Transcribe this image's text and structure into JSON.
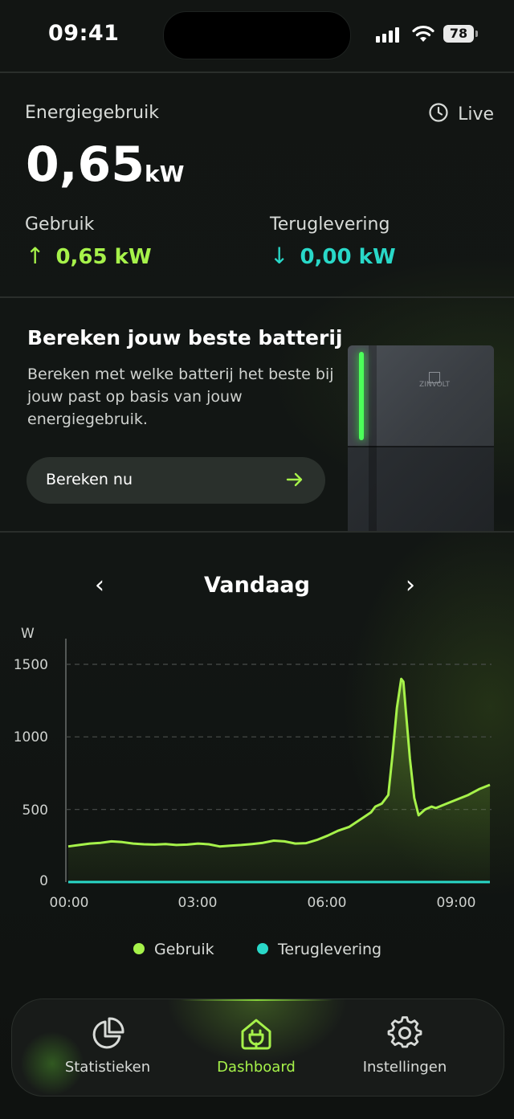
{
  "status_bar": {
    "time": "09:41",
    "battery": "78",
    "icons": [
      "signal-icon",
      "wifi-icon",
      "battery-icon"
    ]
  },
  "energy": {
    "title": "Energiegebruik",
    "live_label": "Live",
    "value": "0,65",
    "unit": "kW",
    "usage": {
      "label": "Gebruik",
      "value": "0,65 kW",
      "arrow": "↑"
    },
    "return": {
      "label": "Teruglevering",
      "value": "0,00 kW",
      "arrow": "↓"
    }
  },
  "promo": {
    "title": "Bereken jouw beste batterij",
    "text": "Bereken met welke batterij het beste bij jouw past op basis van jouw energiegebruik.",
    "button_label": "Bereken nu",
    "device_brand": "ZINVOLT"
  },
  "chart_nav": {
    "label": "Vandaag",
    "prev": "‹",
    "next": "›"
  },
  "chart_data": {
    "type": "line",
    "ylabel": "W",
    "ylim": [
      0,
      1500
    ],
    "yticks": [
      "1500",
      "1000",
      "500",
      "0"
    ],
    "xticks": [
      "00:00",
      "03:00",
      "06:00",
      "09:00"
    ],
    "x_hours": [
      0,
      0.25,
      0.5,
      0.75,
      1,
      1.25,
      1.5,
      1.75,
      2,
      2.25,
      2.5,
      2.75,
      3,
      3.25,
      3.5,
      3.75,
      4,
      4.25,
      4.5,
      4.75,
      5,
      5.25,
      5.5,
      5.75,
      6,
      6.25,
      6.5,
      6.75,
      7,
      7.1,
      7.25,
      7.4,
      7.5,
      7.6,
      7.7,
      7.75,
      7.8,
      7.9,
      8,
      8.1,
      8.25,
      8.4,
      8.5,
      8.75,
      9,
      9.25,
      9.5,
      9.75
    ],
    "series": [
      {
        "name": "Gebruik",
        "color": "#a6f24a",
        "values": [
          245,
          255,
          265,
          270,
          280,
          275,
          265,
          260,
          258,
          262,
          255,
          258,
          265,
          260,
          245,
          250,
          255,
          262,
          270,
          285,
          280,
          265,
          268,
          290,
          320,
          355,
          380,
          430,
          480,
          520,
          540,
          600,
          880,
          1200,
          1400,
          1380,
          1200,
          850,
          580,
          460,
          500,
          520,
          510,
          540,
          570,
          600,
          640,
          670
        ]
      },
      {
        "name": "Teruglevering",
        "color": "#29d8c8",
        "values": [
          0,
          0,
          0,
          0,
          0,
          0,
          0,
          0,
          0,
          0,
          0,
          0,
          0,
          0,
          0,
          0,
          0,
          0,
          0,
          0,
          0,
          0,
          0,
          0,
          0,
          0,
          0,
          0,
          0,
          0,
          0,
          0,
          0,
          0,
          0,
          0,
          0,
          0,
          0,
          0,
          0,
          0,
          0,
          0,
          0,
          0,
          0,
          0
        ]
      }
    ],
    "grid": true,
    "legend": "bottom"
  },
  "tabs": [
    {
      "label": "Statistieken",
      "icon": "pie-chart-icon",
      "active": false
    },
    {
      "label": "Dashboard",
      "icon": "plug-home-icon",
      "active": true
    },
    {
      "label": "Instellingen",
      "icon": "gear-icon",
      "active": false
    }
  ]
}
